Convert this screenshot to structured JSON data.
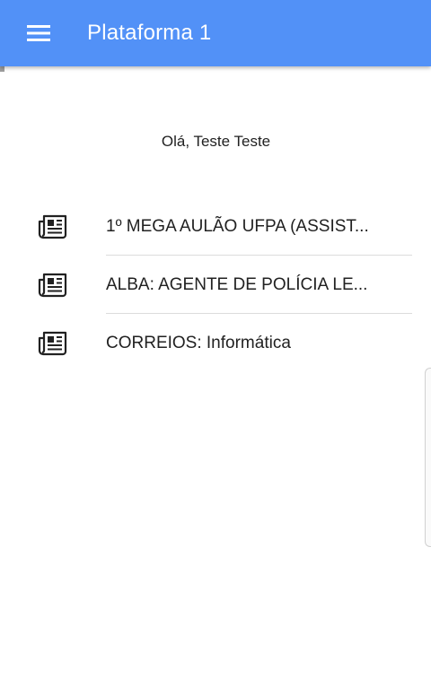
{
  "app_bar": {
    "title": "Plataforma 1",
    "menu_icon": "hamburger-menu-icon",
    "color": "#5291f7"
  },
  "greeting": "Olá, Teste Teste",
  "items": [
    {
      "label": "1º MEGA AULÃO UFPA (ASSIST...",
      "icon": "newspaper-icon"
    },
    {
      "label": "ALBA: AGENTE DE POLÍCIA LE...",
      "icon": "newspaper-icon"
    },
    {
      "label": "CORREIOS: Informática",
      "icon": "newspaper-icon"
    }
  ]
}
